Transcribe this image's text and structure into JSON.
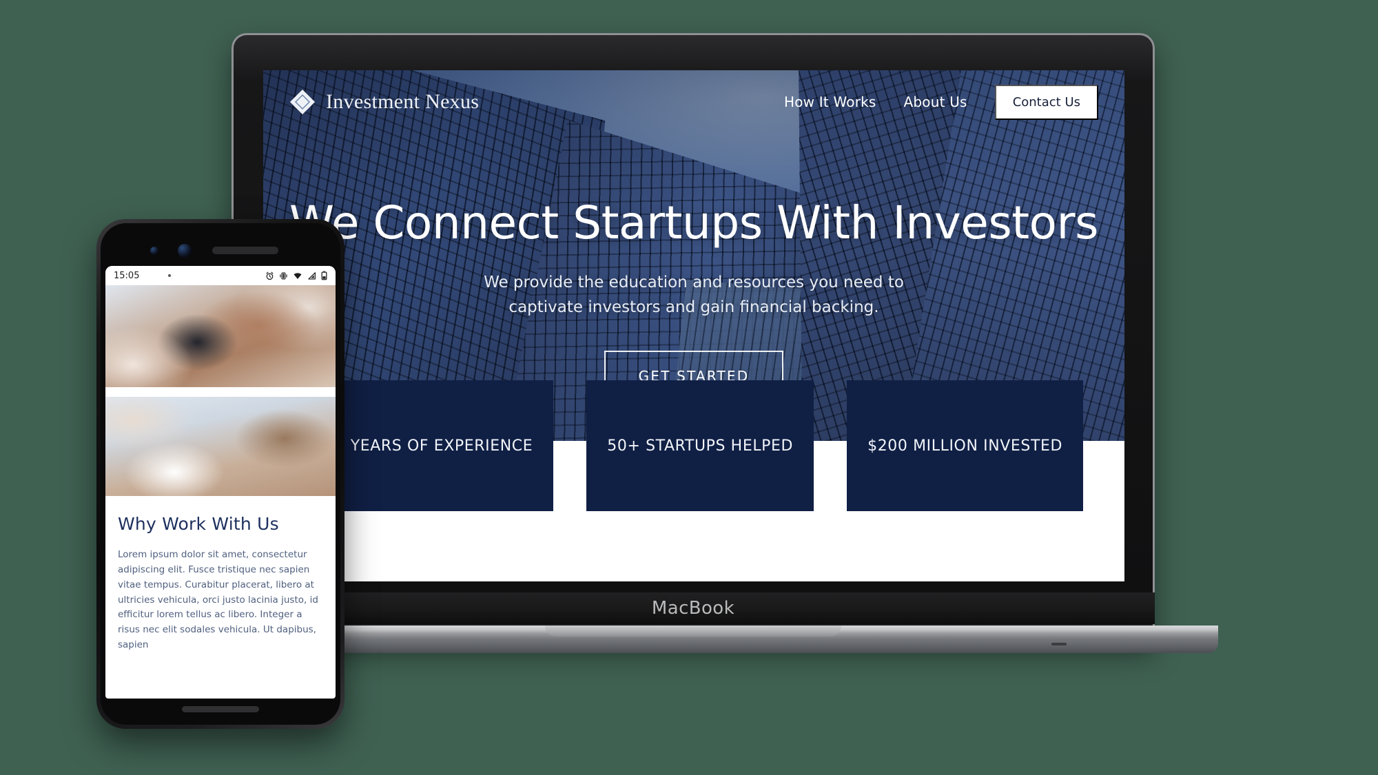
{
  "device_desktop": {
    "brand_label": "MacBook"
  },
  "site": {
    "header": {
      "logo_icon": "diamond-logo-icon",
      "brand_name": "Investment Nexus",
      "nav_links": [
        {
          "label": "How It Works"
        },
        {
          "label": "About Us"
        }
      ],
      "cta_label": "Contact Us"
    },
    "hero": {
      "title": "We Connect Startups With Investors",
      "subtitle_line1": "We provide the education and resources you need to",
      "subtitle_line2": "captivate investors and gain financial backing.",
      "button_label": "GET STARTED"
    },
    "stats": [
      {
        "label": "12 YEARS OF EXPERIENCE"
      },
      {
        "label": "50+ STARTUPS HELPED"
      },
      {
        "label": "$200 MILLION INVESTED"
      }
    ]
  },
  "phone": {
    "status_bar": {
      "time": "15:05",
      "icons": [
        "alarm-icon",
        "vibrate-icon",
        "wifi-icon",
        "signal-icon",
        "battery-icon"
      ]
    },
    "images": [
      {
        "alt": "meeting-hands-writing-photo"
      },
      {
        "alt": "person-writing-notebook-photo"
      }
    ],
    "section": {
      "heading": "Why Work With Us",
      "body": "Lorem ipsum dolor sit amet, consectetur adipiscing elit. Fusce tristique nec sapien vitae tempus. Curabitur placerat, libero at ultricies vehicula, orci justo lacinia justo, id efficitur lorem tellus ac libero. Integer a risus nec elit sodales vehicula. Ut dapibus, sapien"
    }
  },
  "colors": {
    "background": "#3f6152",
    "navy_deep": "#101f44",
    "navy_text": "#1d2f5e",
    "hero_blue": "#25386b",
    "white": "#ffffff"
  }
}
